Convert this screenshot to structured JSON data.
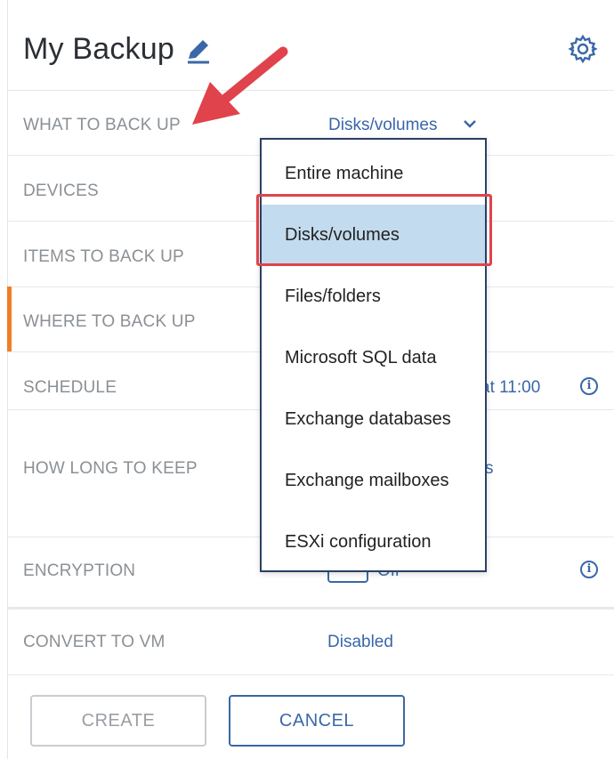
{
  "header": {
    "title": "My Backup",
    "edit_icon": "pencil-icon",
    "settings_icon": "gear-icon"
  },
  "rows": [
    {
      "label": "WHAT TO BACK UP",
      "value": "Disks/volumes"
    },
    {
      "label": "DEVICES",
      "value": ""
    },
    {
      "label": "ITEMS TO BACK UP",
      "value": ""
    },
    {
      "label": "WHERE TO BACK UP",
      "value": ""
    },
    {
      "label": "SCHEDULE",
      "value": "at 11:00"
    },
    {
      "label": "HOW LONG TO KEEP",
      "value": "s"
    },
    {
      "label": "ENCRYPTION",
      "value": "Off"
    },
    {
      "label": "CONVERT TO VM",
      "value": "Disabled"
    }
  ],
  "dropdown": {
    "selected": "Disks/volumes",
    "options": [
      "Entire machine",
      "Disks/volumes",
      "Files/folders",
      "Microsoft SQL data",
      "Exchange databases",
      "Exchange mailboxes",
      "ESXi configuration"
    ]
  },
  "buttons": {
    "create": "CREATE",
    "cancel": "CANCEL"
  },
  "colors": {
    "accent": "#f07e26",
    "link": "#3a67a8",
    "selected_bg": "#c3dbee",
    "annotation": "#e0434b"
  }
}
